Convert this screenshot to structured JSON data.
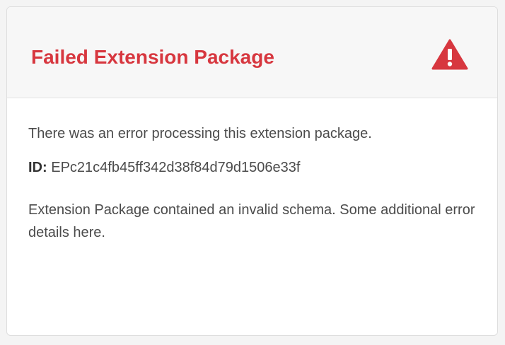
{
  "dialog": {
    "title": "Failed Extension Package",
    "icon": "alert-icon",
    "accent_color": "#d7373f",
    "message": "There was an error processing this extension package.",
    "id_label": "ID:",
    "id_value": "EPc21c4fb45ff342d38f84d79d1506e33f",
    "details": "Extension Package contained an invalid schema. Some additional error details here."
  }
}
